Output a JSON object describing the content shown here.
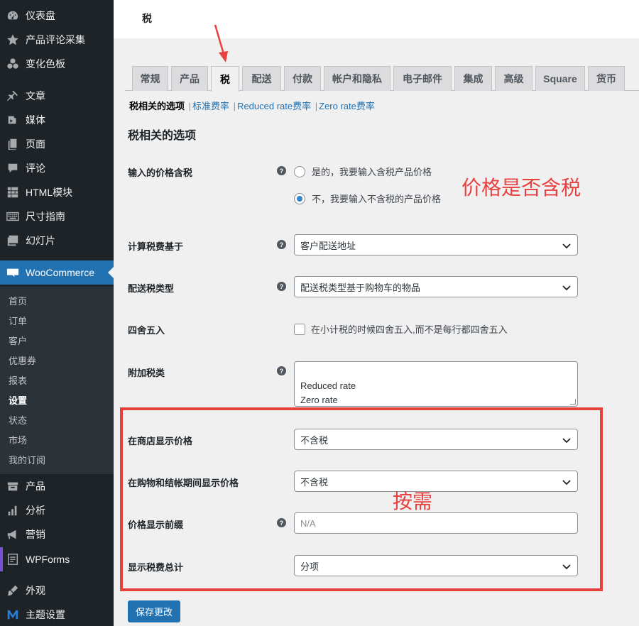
{
  "sidebar": {
    "items": [
      {
        "label": "仪表盘",
        "icon": "dashboard-icon"
      },
      {
        "label": "产品评论采集",
        "icon": "star-icon"
      },
      {
        "label": "变化色板",
        "icon": "swatch-icon"
      },
      {
        "label": "文章",
        "icon": "pin-icon"
      },
      {
        "label": "媒体",
        "icon": "media-icon"
      },
      {
        "label": "页面",
        "icon": "page-icon"
      },
      {
        "label": "评论",
        "icon": "comment-icon"
      },
      {
        "label": "HTML模块",
        "icon": "grid-icon"
      },
      {
        "label": "尺寸指南",
        "icon": "keyboard-icon"
      },
      {
        "label": "幻灯片",
        "icon": "slides-icon"
      },
      {
        "label": "WooCommerce",
        "icon": "woo-icon"
      },
      {
        "label": "产品",
        "icon": "product-icon"
      },
      {
        "label": "分析",
        "icon": "chart-icon"
      },
      {
        "label": "营销",
        "icon": "megaphone-icon"
      },
      {
        "label": "WPForms",
        "icon": "form-icon"
      },
      {
        "label": "外观",
        "icon": "brush-icon"
      },
      {
        "label": "主题设置",
        "icon": "m-logo-icon"
      }
    ],
    "submenu": [
      "首页",
      "订单",
      "客户",
      "优惠券",
      "报表",
      "设置",
      "状态",
      "市场",
      "我的订阅"
    ]
  },
  "header": {
    "title": "税"
  },
  "tabs": [
    "常规",
    "产品",
    "税",
    "配送",
    "付款",
    "帐户和隐私",
    "电子邮件",
    "集成",
    "高级",
    "Square",
    "货币"
  ],
  "subsub": {
    "current": "税相关的选项",
    "links": [
      "标准费率",
      "Reduced rate费率",
      "Zero rate费率"
    ],
    "sep": "|"
  },
  "section_title": "税相关的选项",
  "help_glyph": "?",
  "fields": {
    "prices_include_tax": {
      "label": "输入的价格含税",
      "options": [
        "是的，我要输入含税产品价格",
        "不，我要输入不含税的产品价格"
      ],
      "selected": 1
    },
    "tax_based_on": {
      "label": "计算税费基于",
      "value": "客户配送地址"
    },
    "shipping_tax_class": {
      "label": "配送税类型",
      "value": "配送税类型基于购物车的物品"
    },
    "rounding": {
      "label": "四舍五入",
      "checkbox_label": "在小计税的时候四舍五入,而不是每行都四舍五入"
    },
    "additional_classes": {
      "label": "附加税类",
      "value": "Reduced rate\nZero rate"
    },
    "display_shop": {
      "label": "在商店显示价格",
      "value": "不含税"
    },
    "display_cart": {
      "label": "在购物和结帐期间显示价格",
      "value": "不含税"
    },
    "price_suffix": {
      "label": "价格显示前缀",
      "placeholder": "N/A"
    },
    "display_totals": {
      "label": "显示税费总计",
      "value": "分项"
    }
  },
  "save_button": "保存更改",
  "annotations": {
    "tax_included": "价格是否含税",
    "as_needed": "按需"
  },
  "colors": {
    "accent": "#2271b1",
    "sidebar": "#1d2327",
    "annotation": "#e8403f"
  }
}
